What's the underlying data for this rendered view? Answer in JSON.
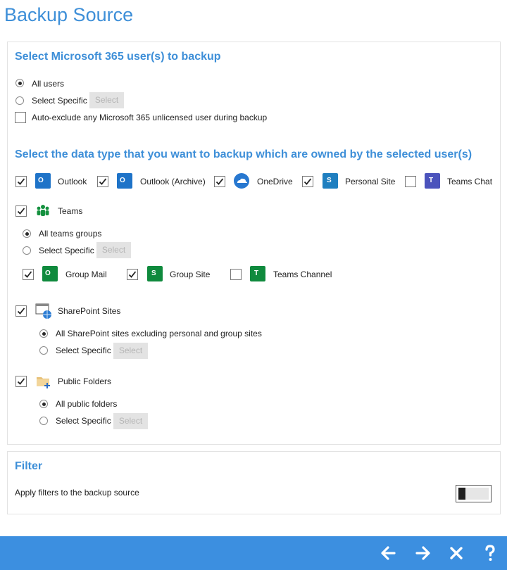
{
  "page": {
    "title": "Backup Source"
  },
  "users": {
    "heading": "Select Microsoft 365 user(s) to backup",
    "all_users": "All users",
    "select_specific": "Select Specific",
    "select_button": "Select",
    "auto_exclude": "Auto-exclude any Microsoft 365 unlicensed user during backup"
  },
  "data_types": {
    "heading": "Select the data type that you want to backup which are owned by the selected user(s)",
    "outlook": "Outlook",
    "outlook_archive": "Outlook (Archive)",
    "onedrive": "OneDrive",
    "personal_site": "Personal Site",
    "teams_chat": "Teams Chat",
    "teams": "Teams",
    "all_teams_groups": "All teams groups",
    "teams_select_specific": "Select Specific",
    "teams_select_button": "Select",
    "group_mail": "Group Mail",
    "group_site": "Group Site",
    "teams_channel": "Teams Channel",
    "sharepoint_sites": "SharePoint Sites",
    "all_sharepoint": "All SharePoint sites excluding personal and group sites",
    "sp_select_specific": "Select Specific",
    "sp_select_button": "Select",
    "public_folders": "Public Folders",
    "all_public_folders": "All public folders",
    "pf_select_specific": "Select Specific",
    "pf_select_button": "Select"
  },
  "filter": {
    "heading": "Filter",
    "apply_label": "Apply filters to the backup source",
    "enabled": false
  },
  "colors": {
    "accent": "#3e8fd8",
    "footer": "#3c8fe0",
    "outlook": "#1e73c8",
    "onedrive": "#2878d0",
    "sharepoint": "#1f7fc0",
    "teams": "#4b53bc",
    "group": "#0f8a3d"
  },
  "icons": {
    "back": "arrow-left-icon",
    "next": "arrow-right-icon",
    "close": "close-icon",
    "help": "help-icon"
  }
}
